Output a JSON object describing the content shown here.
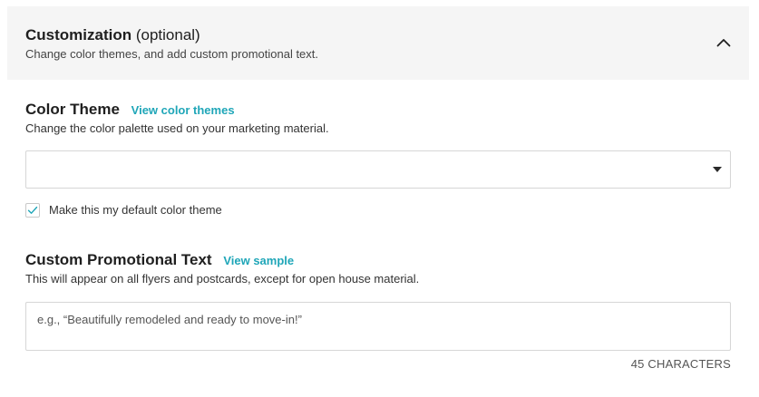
{
  "header": {
    "title_strong": "Customization",
    "title_light": "(optional)",
    "subtitle": "Change color themes, and add custom promotional text.",
    "collapse_icon": "chevron-up-icon"
  },
  "color_theme": {
    "heading": "Color Theme",
    "link": "View color themes",
    "description": "Change the color palette used on your marketing material.",
    "select_value": "",
    "select_icon": "caret-down-icon",
    "default_checkbox": {
      "checked": true,
      "label": "Make this my default color theme",
      "check_color": "#1fa6b8"
    }
  },
  "promo_text": {
    "heading": "Custom Promotional Text",
    "link": "View sample",
    "description": "This will appear on all flyers and postcards, except for open house material.",
    "placeholder": "e.g., “Beautifully remodeled and ready to move-in!”",
    "value": "",
    "char_count": "45 CHARACTERS"
  },
  "colors": {
    "accent": "#1fa6b8",
    "header_bg": "#f5f5f5",
    "border": "#d6d6d6"
  }
}
